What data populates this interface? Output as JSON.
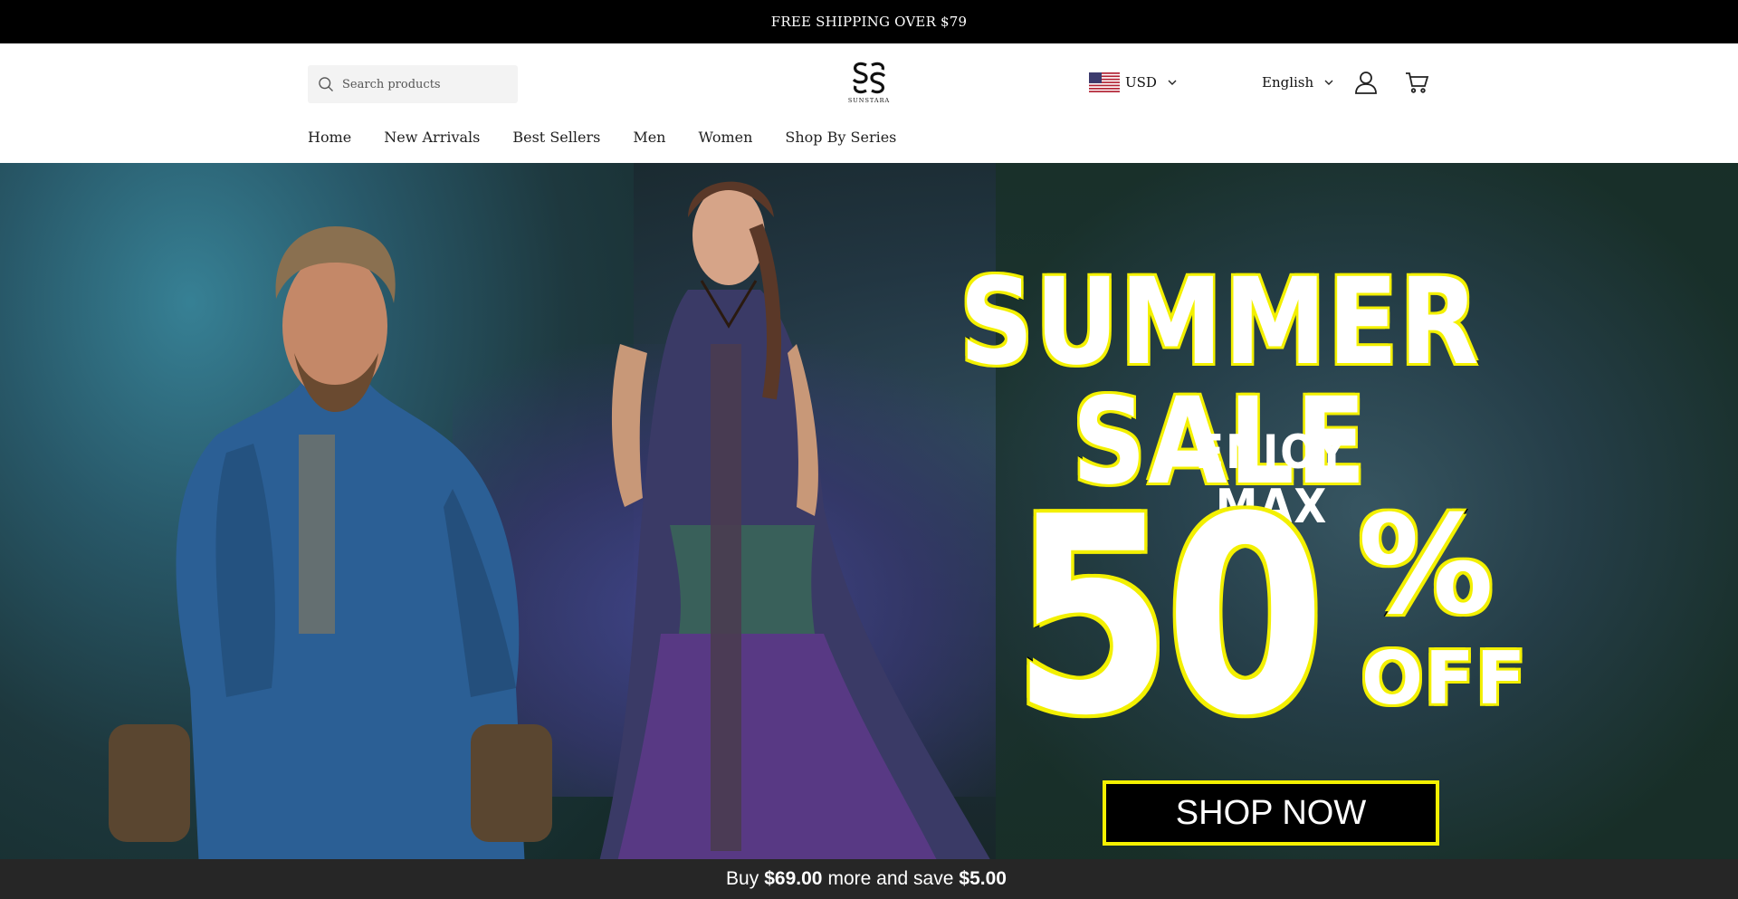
{
  "announcement": {
    "text": "FREE SHIPPING OVER $79"
  },
  "header": {
    "search_placeholder": "Search products",
    "logo_text": "SUNSTARA",
    "currency": "USD",
    "language": "English"
  },
  "nav": {
    "items": [
      {
        "label": "Home"
      },
      {
        "label": "New Arrivals"
      },
      {
        "label": "Best Sellers"
      },
      {
        "label": "Men"
      },
      {
        "label": "Women"
      },
      {
        "label": "Shop By Series"
      }
    ]
  },
  "hero": {
    "title": "SUMMER SALE",
    "subtitle": "ENJOY MAX",
    "discount_number": "50",
    "discount_symbol": "%",
    "discount_word": "OFF",
    "cta_label": "SHOP NOW",
    "accent_color": "#f3f000"
  },
  "savebar": {
    "prefix": "Buy",
    "amount_needed": "$69.00",
    "middle": "more and save",
    "savings": "$5.00"
  }
}
